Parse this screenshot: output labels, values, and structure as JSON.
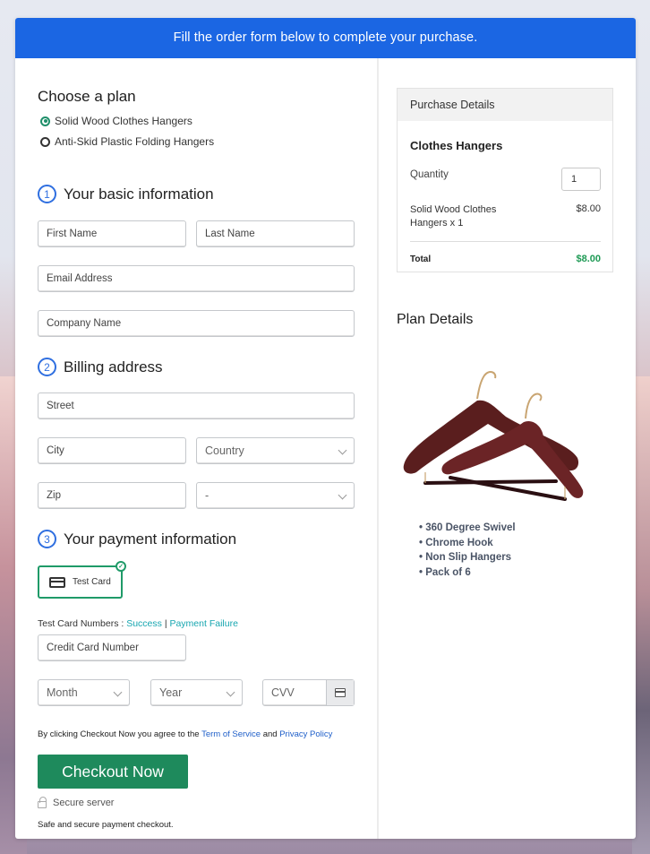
{
  "banner": {
    "text": "Fill the order form below to complete your purchase."
  },
  "plan": {
    "title": "Choose a plan",
    "options": [
      {
        "label": "Solid Wood Clothes Hangers",
        "selected": true
      },
      {
        "label": "Anti-Skid Plastic Folding Hangers",
        "selected": false
      }
    ]
  },
  "basic_info": {
    "number": "1",
    "title": "Your basic information",
    "first_name": {
      "placeholder": "First Name",
      "value": ""
    },
    "last_name": {
      "placeholder": "Last Name",
      "value": ""
    },
    "email": {
      "placeholder": "Email Address",
      "value": ""
    },
    "company": {
      "placeholder": "Company Name",
      "value": ""
    }
  },
  "billing": {
    "number": "2",
    "title": "Billing address",
    "street": {
      "placeholder": "Street",
      "value": ""
    },
    "city": {
      "placeholder": "City",
      "value": ""
    },
    "country": {
      "selected": "Country"
    },
    "zip": {
      "placeholder": "Zip",
      "value": ""
    },
    "state": {
      "selected": "-"
    }
  },
  "payment": {
    "number": "3",
    "title": "Your payment information",
    "method_label": "Test Card",
    "method_selected": true,
    "test_numbers_label": "Test Card Numbers :",
    "success_link": "Success",
    "separator": "|",
    "failure_link": "Payment Failure",
    "card_number": {
      "placeholder": "Credit Card Number",
      "value": ""
    },
    "month": {
      "selected": "Month"
    },
    "year": {
      "selected": "Year"
    },
    "cvv": {
      "placeholder": "CVV",
      "value": ""
    }
  },
  "agreement": {
    "prefix": "By clicking Checkout Now you agree to the",
    "terms_link": "Term of Service",
    "and": "and",
    "privacy_link": "Privacy Policy"
  },
  "checkout_button": "Checkout Now",
  "secure_label": "Secure server",
  "safe_text": "Safe and secure payment checkout.",
  "purchase": {
    "header": "Purchase Details",
    "product": "Clothes Hangers",
    "quantity_label": "Quantity",
    "quantity": "1",
    "line_item": "Solid Wood Clothes Hangers x 1",
    "line_price": "$8.00",
    "total_label": "Total",
    "total": "$8.00",
    "total_color": "#1e9a55"
  },
  "plan_details": {
    "title": "Plan Details",
    "image": "wooden-clothes-hangers",
    "features": [
      "360 Degree Swivel",
      "Chrome Hook",
      "Non Slip Hangers",
      "Pack of 6"
    ]
  },
  "colors": {
    "banner": "#1b66e3",
    "checkout": "#1e8a5c",
    "accent_teal": "#17a6b0",
    "link_blue": "#1f5fc9",
    "step_blue": "#2f6fe0"
  }
}
